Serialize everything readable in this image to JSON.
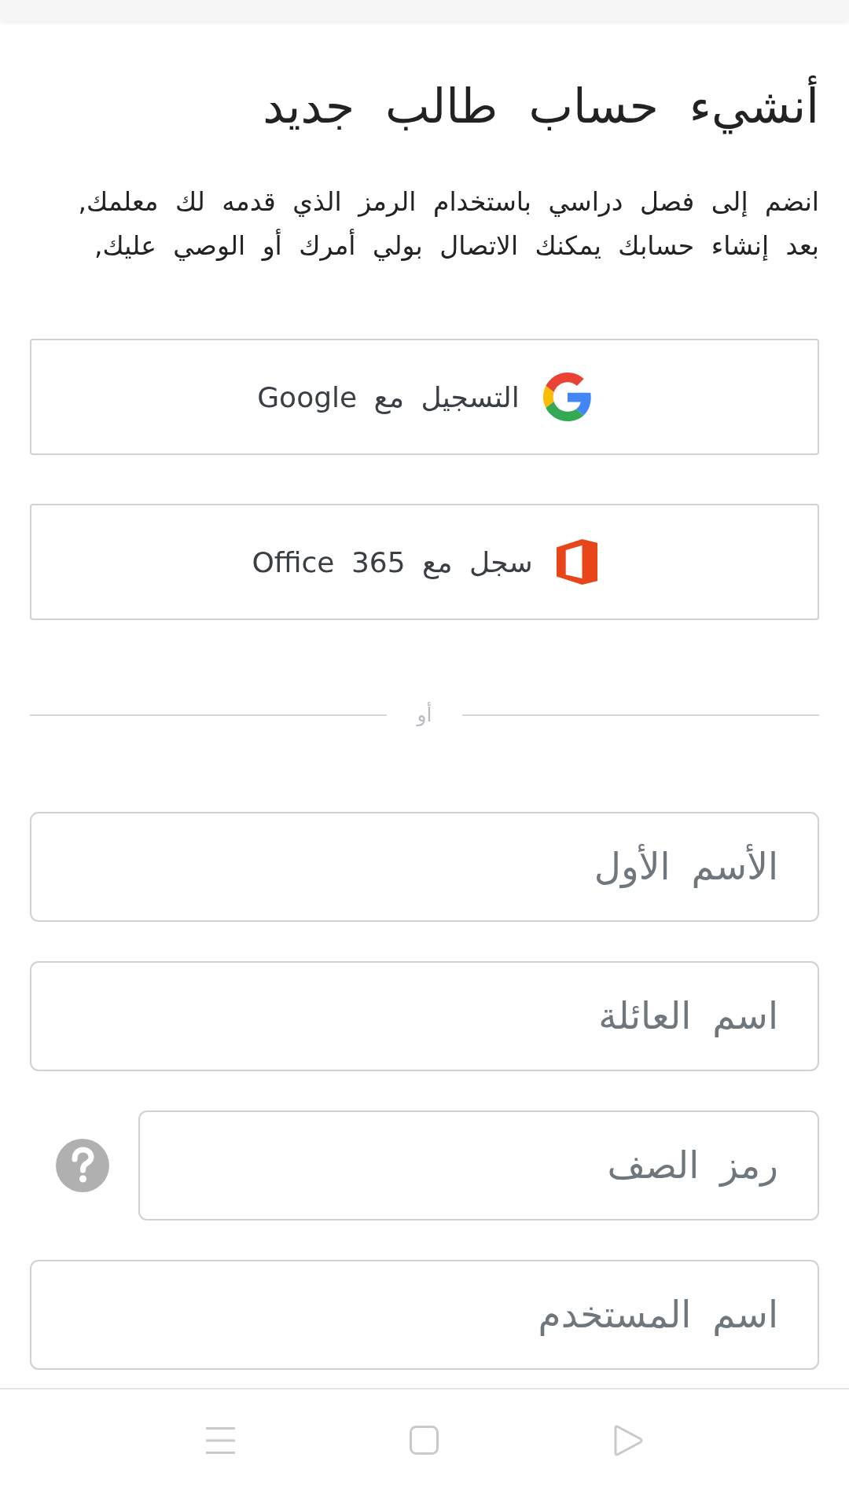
{
  "title": "أنشيء حساب طالب جديد",
  "intro": "انضم إلى فصل دراسي باستخدام الرمز الذي قدمه لك معلمك, بعد إنشاء حسابك يمكنك الاتصال بولي أمرك أو الوصي عليك,",
  "sign_in_buttons": [
    {
      "kind": "google",
      "label": "التسجيل مع Google"
    },
    {
      "kind": "office",
      "label": "سجل مع Office 365"
    }
  ],
  "divider": {
    "label": "أو"
  },
  "fields": [
    {
      "placeholder": "الأسم الأول",
      "help": false
    },
    {
      "placeholder": "اسم العائلة",
      "help": false
    },
    {
      "placeholder": "رمز الصف",
      "help": true
    },
    {
      "placeholder": "اسم المستخدم",
      "help": false
    }
  ]
}
